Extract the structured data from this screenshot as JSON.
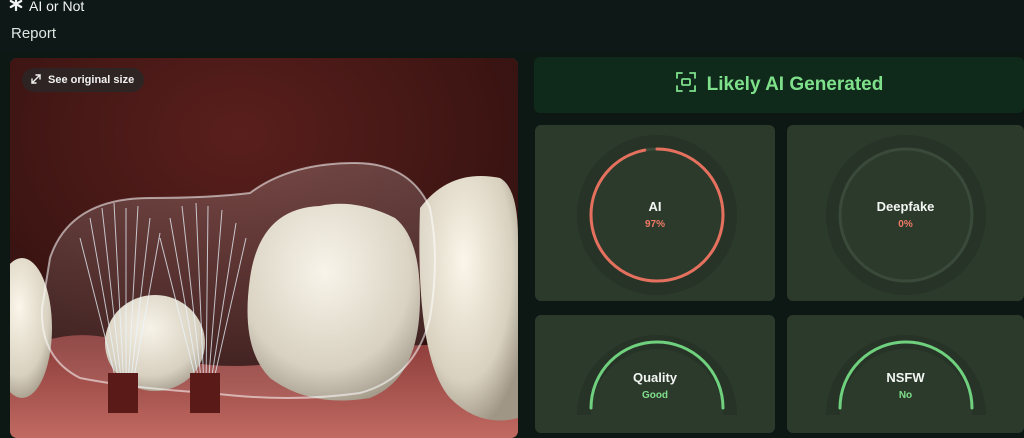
{
  "app": {
    "name": "AI or Not",
    "logo_icon": "asterisk-logo-icon"
  },
  "page": {
    "title": "Report"
  },
  "image_panel": {
    "see_original_label": "See original size",
    "expand_icon": "expand-arrows-icon"
  },
  "verdict": {
    "label": "Likely AI Generated",
    "icon": "scan-frame-icon",
    "color": "#7fe08c"
  },
  "metrics": [
    {
      "key": "ai",
      "label": "AI",
      "value": "97%",
      "fraction": 0.97,
      "value_color": "#ef7a64",
      "ring_color": "#e5705e"
    },
    {
      "key": "deepfake",
      "label": "Deepfake",
      "value": "0%",
      "fraction": 0.0,
      "value_color": "#ef7a64",
      "ring_color": "#e5705e"
    },
    {
      "key": "quality",
      "label": "Quality",
      "value": "Good",
      "fraction": 1.0,
      "value_color": "#7fe08c",
      "ring_color": "#6fd07e"
    },
    {
      "key": "nsfw",
      "label": "NSFW",
      "value": "No",
      "fraction": 1.0,
      "value_color": "#7fe08c",
      "ring_color": "#6fd07e"
    }
  ]
}
